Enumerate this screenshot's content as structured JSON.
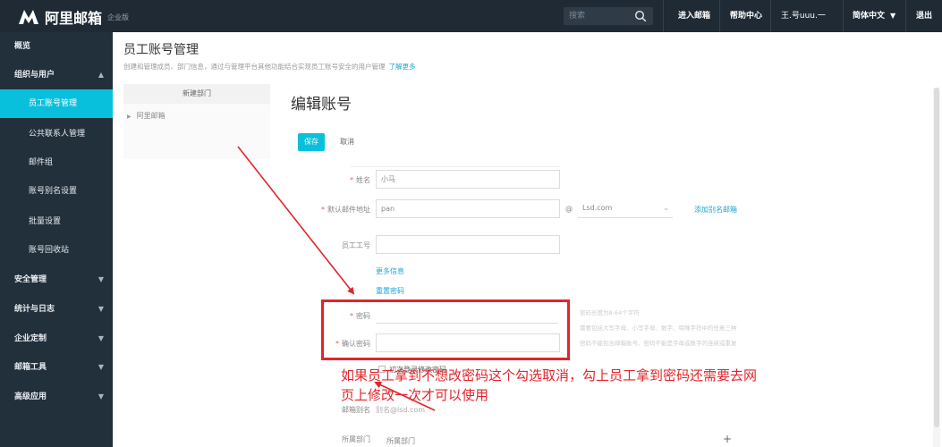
{
  "header": {
    "logo_text": "阿里邮箱",
    "logo_sub": "企业版",
    "search_placeholder": "搜索",
    "nav": {
      "enter_mail": "进入邮箱",
      "help": "帮助中心",
      "user": "王.号uuu.一",
      "language": "简体中文",
      "logout": "退出"
    }
  },
  "sidebar": {
    "overview": "概览",
    "org_users": "组织与用户",
    "sub_items": [
      "员工账号管理",
      "公共联系人管理",
      "邮件组",
      "账号别名设置",
      "批量设置",
      "账号回收站"
    ],
    "sections": [
      "安全管理",
      "统计与日志",
      "企业定制",
      "邮箱工具",
      "高级应用"
    ]
  },
  "main": {
    "page_title": "员工账号管理",
    "page_desc": "创建和管理成员、部门信息，通过与管理平台其他功能结合实现员工账号安全的用户管理",
    "learn_more": "了解更多",
    "new_dept": "新建部门",
    "tree_node": "阿里邮箱",
    "edit_title": "编辑账号",
    "save": "保存",
    "cancel": "取消",
    "form": {
      "name_label": "姓名",
      "name_value": "小马",
      "email_label": "默认邮件地址",
      "email_value": "pan",
      "at": "@",
      "domain_value": "Lsd.com",
      "add_alias": "添加别名邮箱",
      "employee_no_label": "员工工号",
      "more_info": "更多信息",
      "reset_password": "重置密码",
      "password_label": "密码",
      "confirm_label": "确认密码",
      "hints": [
        "密码长度为8-64个字符",
        "需要包括大写字母、小写字母、数字、特殊字符中的任意三种",
        "密码不能包含邮箱账号、密码不能是字母或数字的连续或重复"
      ],
      "first_login": "初次登录修改密码",
      "alias_label": "邮箱别名",
      "alias_value": "别名@lsd.com",
      "dept_label": "所属部门",
      "dept_value": "所属部门"
    },
    "annotation_line1": "如果员工拿到不想改密码这个勾选取消，勾上员工拿到密码还需要去网",
    "annotation_line2": "页上修改一次才可以使用"
  },
  "colors": {
    "topbar": "#1f2a35",
    "sidebar": "#22303c",
    "accent": "#08c0dc",
    "annotation_red": "#e3242b",
    "link": "#19a7d8"
  }
}
